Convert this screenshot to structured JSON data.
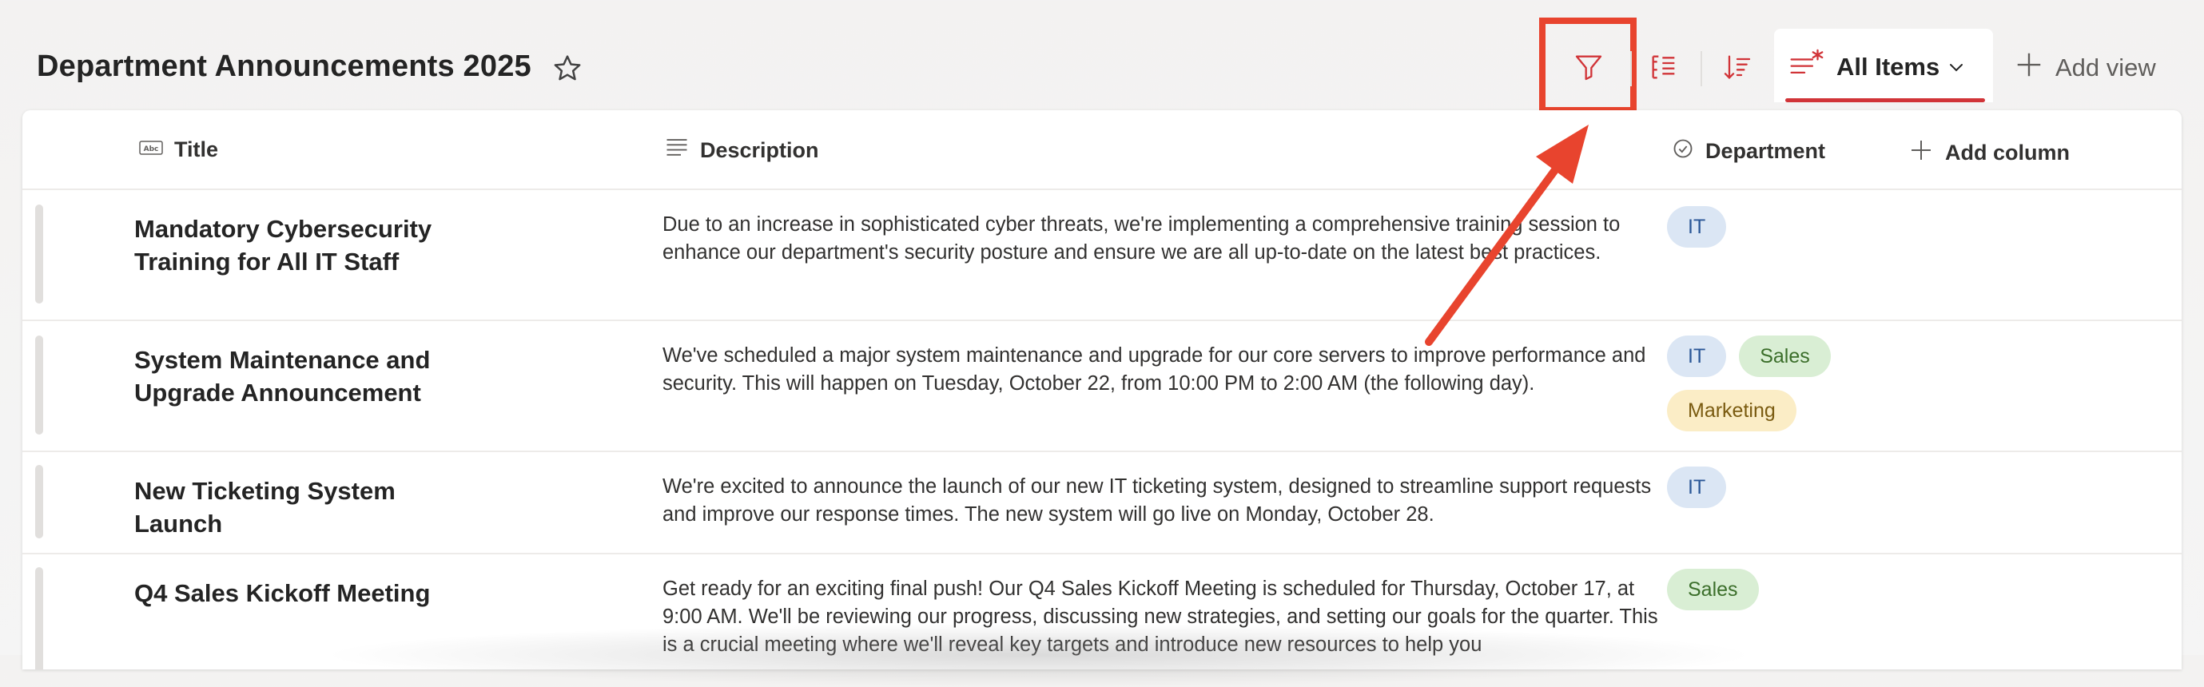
{
  "header": {
    "title": "Department Announcements 2025",
    "favorite_icon": "star-icon",
    "toolbar": {
      "filter_icon": "filter-icon",
      "group_icon": "group-by-icon",
      "sort_icon": "sort-icon"
    },
    "view_tab": {
      "label": "All Items",
      "icon": "view-list-icon"
    },
    "add_view_label": "Add view"
  },
  "columns": {
    "title": "Title",
    "description": "Description",
    "department": "Department",
    "add_column": "Add column"
  },
  "rows": [
    {
      "title": "Mandatory Cybersecurity Training for All IT Staff",
      "description": "Due to an increase in sophisticated cyber threats, we're implementing a comprehensive training session to enhance our department's security posture and ensure we are all up-to-date on the latest best practices.",
      "tags": [
        "IT"
      ]
    },
    {
      "title": "System Maintenance and Upgrade Announcement",
      "description": "We've scheduled a major system maintenance and upgrade for our core servers to improve performance and security. This will happen on Tuesday, October 22, from 10:00 PM to 2:00 AM (the following day).",
      "tags": [
        "IT",
        "Sales",
        "Marketing"
      ]
    },
    {
      "title": "New Ticketing System Launch",
      "description": "We're excited to announce the launch of our new IT ticketing system, designed to streamline support requests and improve our response times. The new system will go live on Monday, October 28.",
      "tags": [
        "IT"
      ]
    },
    {
      "title": "Q4 Sales Kickoff Meeting",
      "description": "Get ready for an exciting final push! Our Q4 Sales Kickoff Meeting is scheduled for Thursday, October 17, at 9:00 AM. We'll be reviewing our progress, discussing new strategies, and setting our goals for the quarter. This is a crucial meeting where we'll reveal key targets and introduce new resources to help you",
      "tags": [
        "Sales"
      ]
    }
  ],
  "colors": {
    "accent": "#d13438",
    "annotation": "#e8442e",
    "tag_it_bg": "#dbe6f4",
    "tag_sales_bg": "#d9eed4",
    "tag_marketing_bg": "#fbedc6"
  }
}
